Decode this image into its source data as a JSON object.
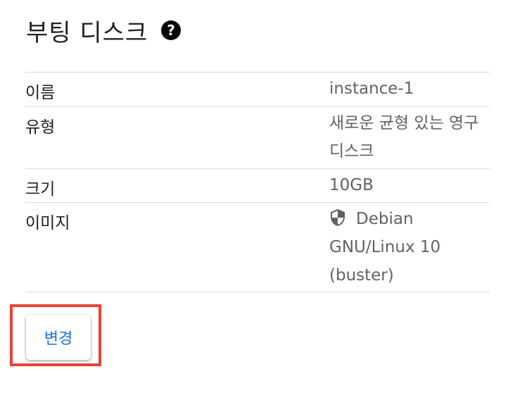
{
  "section": {
    "title": "부팅 디스크",
    "help_icon": "help-circle-icon"
  },
  "details": {
    "rows": [
      {
        "label": "이름",
        "value": "instance-1"
      },
      {
        "label": "유형",
        "value_lines": [
          "새로운 균형 있는 영구",
          "디스크"
        ]
      },
      {
        "label": "크기",
        "value": "10GB"
      },
      {
        "label": "이미지",
        "icon": "shield-icon",
        "value_lines": [
          "Debian",
          "GNU/Linux 10",
          "(buster)"
        ]
      }
    ]
  },
  "actions": {
    "change_label": "변경",
    "highlight_color": "#ea4335",
    "accent_color": "#1a73e8"
  }
}
